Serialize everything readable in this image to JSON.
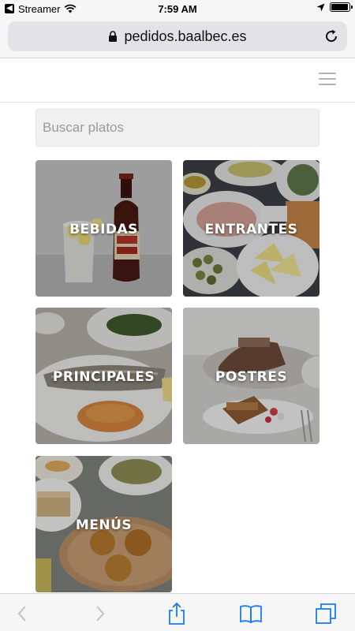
{
  "status_bar": {
    "back_app": "Streamer",
    "time": "7:59 AM",
    "battery_percent": 95
  },
  "browser": {
    "url": "pedidos.baalbec.es",
    "icons": [
      "lock-icon",
      "reload-icon",
      "back-arrow-icon",
      "forward-arrow-icon",
      "share-icon",
      "bookmarks-icon",
      "tabs-icon"
    ]
  },
  "header": {
    "menu_icon": "hamburger-menu-icon"
  },
  "search": {
    "placeholder": "Buscar platos",
    "value": ""
  },
  "categories": [
    {
      "label": "BEBIDAS"
    },
    {
      "label": "ENTRANTES"
    },
    {
      "label": "PRINCIPALES"
    },
    {
      "label": "POSTRES"
    },
    {
      "label": "MENÚS"
    }
  ],
  "colors": {
    "tile_overlay": "#000000",
    "toolbar_accent": "#1a7cf5",
    "disabled": "#c6c6cb"
  }
}
